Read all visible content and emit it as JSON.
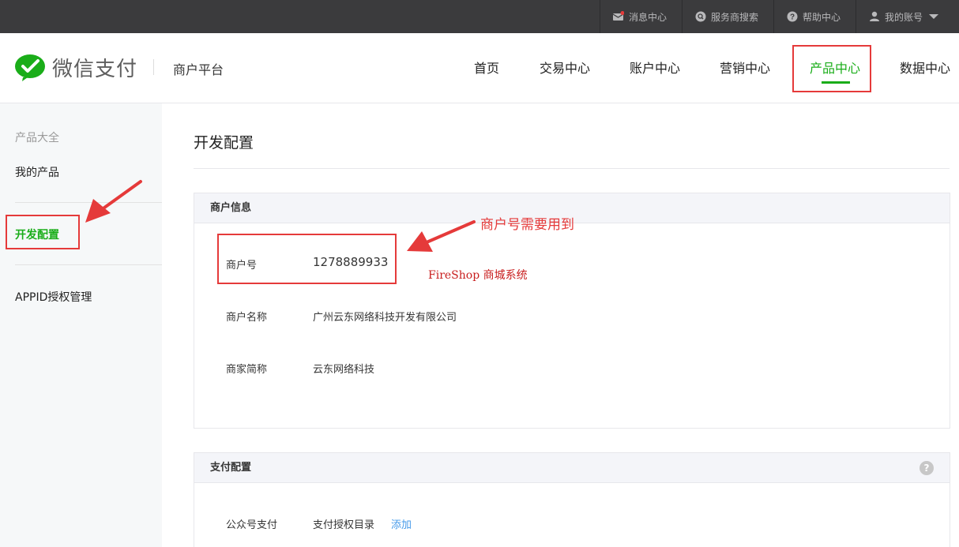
{
  "topbar": {
    "messages": "消息中心",
    "provider_search": "服务商搜索",
    "help": "帮助中心",
    "account": "我的账号"
  },
  "header": {
    "logo_text": "微信支付",
    "platform": "商户平台",
    "nav": [
      "首页",
      "交易中心",
      "账户中心",
      "营销中心",
      "产品中心",
      "数据中心"
    ],
    "active_nav": "产品中心"
  },
  "sidebar": {
    "title": "产品大全",
    "items": [
      "我的产品",
      "开发配置",
      "APPID授权管理"
    ],
    "active": "开发配置"
  },
  "main": {
    "title": "开发配置",
    "merchant_panel": {
      "heading": "商户信息",
      "rows": [
        {
          "label": "商户号",
          "value": "1278889933"
        },
        {
          "label": "商户名称",
          "value": "广州云东网络科技开发有限公司"
        },
        {
          "label": "商家简称",
          "value": "云东网络科技"
        }
      ]
    },
    "payment_panel": {
      "heading": "支付配置",
      "rows": [
        {
          "label": "公众号支付",
          "value": "支付授权目录",
          "action": "添加"
        }
      ]
    }
  },
  "annotations": {
    "merchant_id_note": "商户号需要用到",
    "system_note": "FireShop 商城系统"
  },
  "colors": {
    "topbar": "#3b3b3d",
    "accent_green": "#1aad19",
    "annotation_red": "#e53a3a",
    "link_blue": "#459ae9"
  }
}
